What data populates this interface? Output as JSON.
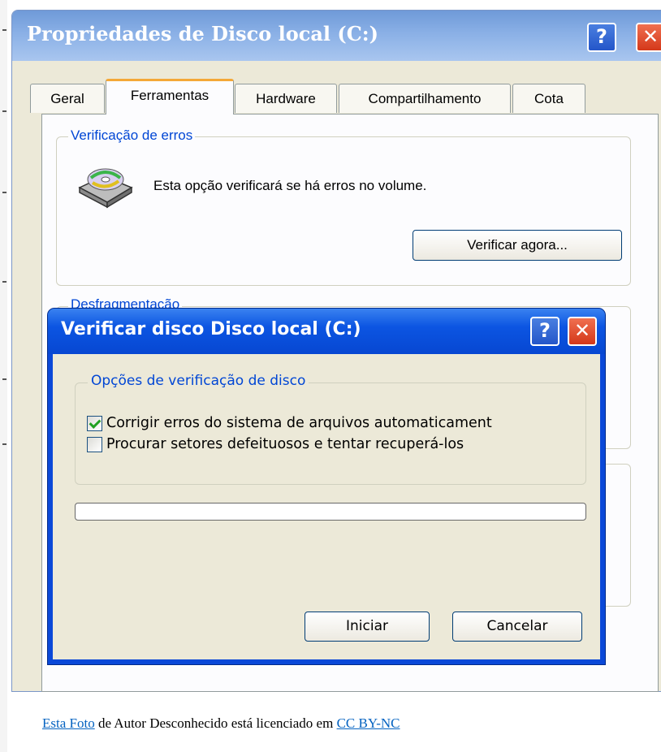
{
  "main_window": {
    "title": "Propriedades de Disco local (C:)",
    "help_glyph": "?",
    "close_glyph": "✕",
    "tabs": [
      {
        "label": "Geral",
        "active": false
      },
      {
        "label": "Ferramentas",
        "active": true
      },
      {
        "label": "Hardware",
        "active": false
      },
      {
        "label": "Compartilhamento",
        "active": false
      },
      {
        "label": "Cota",
        "active": false
      }
    ],
    "error_check": {
      "group_label": "Verificação de erros",
      "description": "Esta opção verificará se há erros no volume.",
      "icon": "disk-check-icon",
      "button": "Verificar agora..."
    },
    "defrag": {
      "group_label": "Desfragmentação"
    }
  },
  "check_dialog": {
    "title": "Verificar disco Disco local (C:)",
    "help_glyph": "?",
    "close_glyph": "✕",
    "group_label": "Opções de verificação de disco",
    "options": [
      {
        "label": "Corrigir erros do sistema de arquivos automaticament",
        "checked": true
      },
      {
        "label": "Procurar setores defeituosos e tentar recuperá-los",
        "checked": false
      }
    ],
    "progress": 0,
    "start_button": "Iniciar",
    "cancel_button": "Cancelar"
  },
  "caption": {
    "link_text": "Esta Foto",
    "middle_text": " de Autor Desconhecido está licenciado em ",
    "license_text": "CC BY-NC"
  },
  "colors": {
    "title_bar_inactive": "#8ab0e6",
    "title_bar_active": "#0c55e2",
    "group_label": "#0046d5",
    "window_face": "#ece9d8",
    "link": "#0563c1"
  }
}
